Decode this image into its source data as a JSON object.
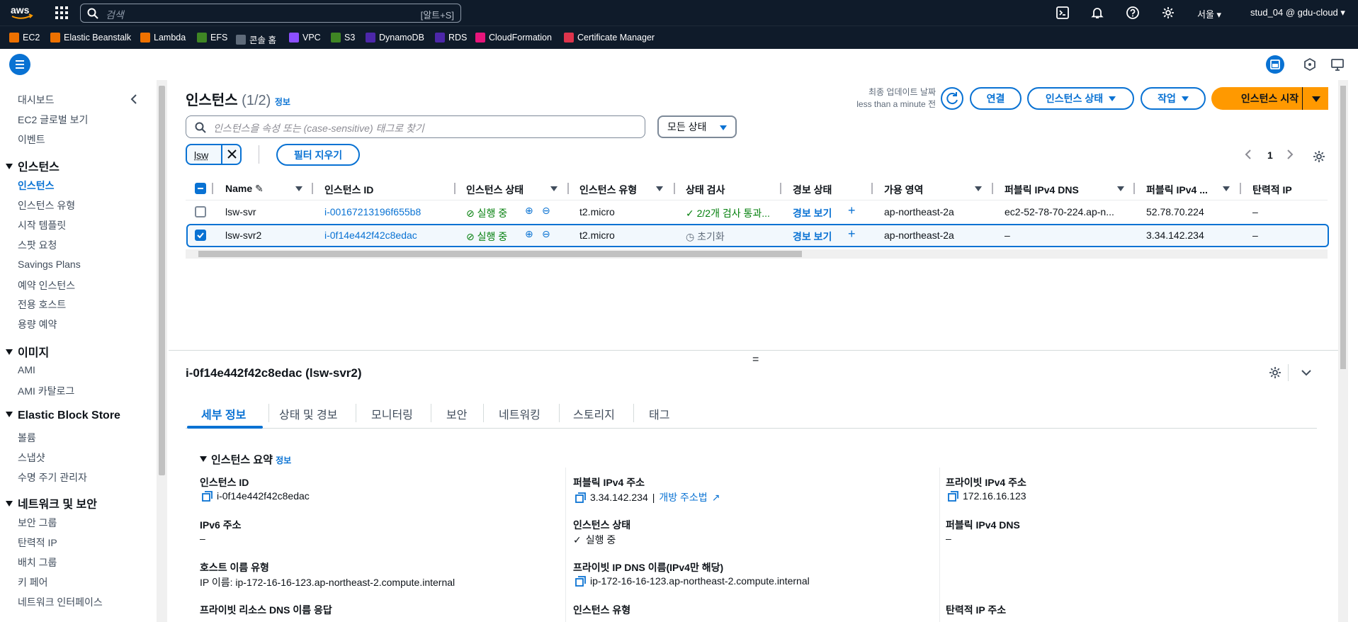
{
  "topbar": {
    "search_placeholder": "검색",
    "search_shortcut": "[알트+S]",
    "region": "서울",
    "user": "stud_04 @ gdu-cloud"
  },
  "favorites": [
    {
      "label": "EC2",
      "color": "#ed7100"
    },
    {
      "label": "Elastic Beanstalk",
      "color": "#ed7100"
    },
    {
      "label": "Lambda",
      "color": "#ed7100"
    },
    {
      "label": "EFS",
      "color": "#3f8624"
    },
    {
      "label": "콘솔 홈",
      "color": "#5f6b7a"
    },
    {
      "label": "VPC",
      "color": "#8c4fff"
    },
    {
      "label": "S3",
      "color": "#3f8624"
    },
    {
      "label": "DynamoDB",
      "color": "#4d27aa"
    },
    {
      "label": "RDS",
      "color": "#4d27aa"
    },
    {
      "label": "CloudFormation",
      "color": "#e7157b"
    },
    {
      "label": "Certificate Manager",
      "color": "#dd344c"
    }
  ],
  "sidebar": {
    "top_items": [
      "대시보드",
      "EC2 글로벌 보기",
      "이벤트"
    ],
    "sections": [
      {
        "title": "인스턴스",
        "items": [
          "인스턴스",
          "인스턴스 유형",
          "시작 템플릿",
          "스팟 요청",
          "Savings Plans",
          "예약 인스턴스",
          "전용 호스트",
          "용량 예약"
        ]
      },
      {
        "title": "이미지",
        "items": [
          "AMI",
          "AMI 카탈로그"
        ]
      },
      {
        "title": "Elastic Block Store",
        "items": [
          "볼륨",
          "스냅샷",
          "수명 주기 관리자"
        ]
      },
      {
        "title": "네트워크 및 보안",
        "items": [
          "보안 그룹",
          "탄력적 IP",
          "배치 그룹",
          "키 페어",
          "네트워크 인터페이스"
        ]
      }
    ],
    "active": "인스턴스"
  },
  "header": {
    "title": "인스턴스",
    "count": "(1/2)",
    "info": "정보",
    "last_updated_label": "최종 업데이트 날짜",
    "last_updated_value": "less than a minute 전",
    "connect": "연결",
    "instance_state": "인스턴스 상태",
    "actions": "작업",
    "launch": "인스턴스 시작"
  },
  "filter": {
    "placeholder": "인스턴스을 속성 또는 (case-sensitive) 태그로 찾기",
    "state_select": "모든 상태",
    "token": "lsw",
    "clear": "필터 지우기",
    "page": "1"
  },
  "table": {
    "columns": [
      "Name",
      "인스턴스 ID",
      "인스턴스 상태",
      "인스턴스 유형",
      "상태 검사",
      "경보 상태",
      "가용 영역",
      "퍼블릭 IPv4 DNS",
      "퍼블릭 IPv4 ...",
      "탄력적 IP"
    ],
    "rows": [
      {
        "name": "lsw-svr",
        "id": "i-00167213196f655b8",
        "state": "실행 중",
        "type": "t2.micro",
        "check": "2/2개 검사 통과...",
        "alarm": "경보 보기",
        "az": "ap-northeast-2a",
        "dns": "ec2-52-78-70-224.ap-n...",
        "ip": "52.78.70.224",
        "eip": "–",
        "selected": false
      },
      {
        "name": "lsw-svr2",
        "id": "i-0f14e442f42c8edac",
        "state": "실행 중",
        "type": "t2.micro",
        "check": "초기화",
        "alarm": "경보 보기",
        "az": "ap-northeast-2a",
        "dns": "–",
        "ip": "3.34.142.234",
        "eip": "–",
        "selected": true
      }
    ]
  },
  "details": {
    "title": "i-0f14e442f42c8edac (lsw-svr2)",
    "tabs": [
      "세부 정보",
      "상태 및 경보",
      "모니터링",
      "보안",
      "네트워킹",
      "스토리지",
      "태그"
    ],
    "section_title": "인스턴스 요약",
    "section_info": "정보",
    "fields": {
      "instance_id_label": "인스턴스 ID",
      "instance_id": "i-0f14e442f42c8edac",
      "public_ipv4_label": "퍼블릭 IPv4 주소",
      "public_ipv4": "3.34.142.234",
      "open_address": "개방 주소법",
      "private_ipv4_label": "프라이빗 IPv4 주소",
      "private_ipv4": "172.16.16.123",
      "ipv6_label": "IPv6 주소",
      "ipv6": "–",
      "instance_state_label": "인스턴스 상태",
      "instance_state": "실행 중",
      "public_dns_label": "퍼블릭 IPv4 DNS",
      "public_dns": "–",
      "hostname_type_label": "호스트 이름 유형",
      "hostname_type": "IP 이름: ip-172-16-16-123.ap-northeast-2.compute.internal",
      "private_dns_label": "프라이빗 IP DNS 이름(IPv4만 해당)",
      "private_dns": "ip-172-16-16-123.ap-northeast-2.compute.internal",
      "private_resource_dns_label": "프라이빗 리소스 DNS 이름 응답",
      "instance_type_label": "인스턴스 유형",
      "eip_label": "탄력적 IP 주소"
    }
  }
}
